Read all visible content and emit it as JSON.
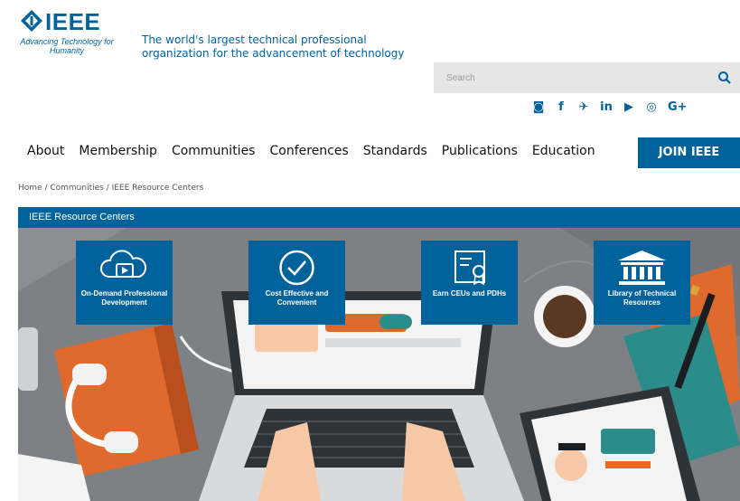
{
  "brand": {
    "name": "IEEE",
    "tagline_short": "Advancing Technology for Humanity",
    "tagline_long": "The world's largest technical professional organization for the advancement of technology"
  },
  "search": {
    "placeholder": "Search"
  },
  "social": [
    "instagram-icon",
    "facebook-icon",
    "twitter-icon",
    "linkedin-icon",
    "youtube-icon",
    "rss-icon",
    "googleplus-icon"
  ],
  "nav": {
    "items": [
      "About",
      "Membership",
      "Communities",
      "Conferences",
      "Standards",
      "Publications",
      "Education"
    ],
    "join_label": "JOIN IEEE"
  },
  "breadcrumb": "Home / Communities / IEEE Resource Centers",
  "banner": {
    "title": "IEEE Resource Centers"
  },
  "tiles": [
    {
      "label": "On-Demand Professional Development",
      "icon": "cloud-play-icon"
    },
    {
      "label": "Cost Effective and Convenient",
      "icon": "checkmark-circle-icon"
    },
    {
      "label": "Earn CEUs and PDHs",
      "icon": "certificate-icon"
    },
    {
      "label": "Library of Technical Resources",
      "icon": "library-building-icon"
    }
  ],
  "colors": {
    "brand_blue": "#00629b",
    "search_bg": "#e6e6e6",
    "hero_bg": "#7b7f84",
    "accent_orange": "#e0692d",
    "accent_teal": "#2b8c8a"
  }
}
